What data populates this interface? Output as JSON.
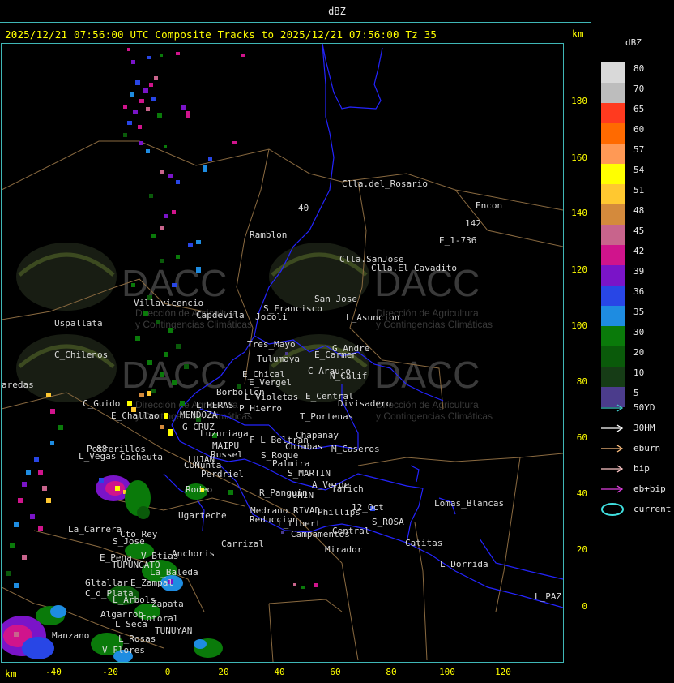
{
  "window_title": "dBZ",
  "subtitle": "2025/12/21 07:56:00 UTC Composite Tracks to 2025/12/21 07:56:00 Tz 35",
  "axis_unit": "km",
  "y_ticks": [
    "180",
    "160",
    "140",
    "120",
    "100",
    "80",
    "60",
    "40",
    "20",
    "0"
  ],
  "x_ticks": [
    "-40",
    "-20",
    "0",
    "20",
    "40",
    "60",
    "80",
    "100",
    "120"
  ],
  "legend": {
    "title": "dBZ",
    "scale": [
      {
        "label": "80",
        "color": "#d9d9d9"
      },
      {
        "label": "70",
        "color": "#bdbdbd"
      },
      {
        "label": "65",
        "color": "#ff3a1f"
      },
      {
        "label": "60",
        "color": "#ff6a00"
      },
      {
        "label": "57",
        "color": "#ff9955"
      },
      {
        "label": "54",
        "color": "#ffff00"
      },
      {
        "label": "51",
        "color": "#ffc830"
      },
      {
        "label": "48",
        "color": "#d48a3c"
      },
      {
        "label": "45",
        "color": "#c8648c"
      },
      {
        "label": "42",
        "color": "#d0148c"
      },
      {
        "label": "39",
        "color": "#7a14c8"
      },
      {
        "label": "36",
        "color": "#2846e6"
      },
      {
        "label": "35",
        "color": "#1e8ce1"
      },
      {
        "label": "30",
        "color": "#0a7a0a"
      },
      {
        "label": "20",
        "color": "#0a5a0a"
      },
      {
        "label": "10",
        "color": "#163c16"
      },
      {
        "label": "5",
        "color": "#4b3c8c"
      }
    ],
    "tracks": [
      {
        "label": "50YD",
        "color": "#40c8c8",
        "icon": "arrow-right-icon"
      },
      {
        "label": "30HM",
        "color": "#ffffff",
        "icon": "arrow-right-icon"
      },
      {
        "label": "eburn",
        "color": "#ffc080",
        "icon": "arrow-right-icon"
      },
      {
        "label": "bip",
        "color": "#ffc8c8",
        "icon": "arrow-right-icon"
      },
      {
        "label": "eb+bip",
        "color": "#e040e0",
        "icon": "arrow-right-icon"
      },
      {
        "label": "current",
        "color": "#40e0e0",
        "icon": "ellipse-icon"
      }
    ]
  },
  "watermark": {
    "brand": "DACC",
    "line1": "Dirección de Agricultura",
    "line2": "y Contingencias Climáticas"
  },
  "places": [
    {
      "name": "Clla.del_Rosario"
    },
    {
      "name": "Encon"
    },
    {
      "name": "142"
    },
    {
      "name": "E_1-736"
    },
    {
      "name": "Ramblon"
    },
    {
      "name": "Clla.SanJose"
    },
    {
      "name": "Clla.El_Cavadito"
    },
    {
      "name": "Villavicencio"
    },
    {
      "name": "Uspallata"
    },
    {
      "name": "Capdevila"
    },
    {
      "name": "S_Francisco"
    },
    {
      "name": "Jocoli"
    },
    {
      "name": "San Jose"
    },
    {
      "name": "L_Asuncion"
    },
    {
      "name": "Tres_Mayo"
    },
    {
      "name": "Tulumaya"
    },
    {
      "name": "G_Andre"
    },
    {
      "name": "E_Carmen"
    },
    {
      "name": "C_Chilenos"
    },
    {
      "name": "E_Chical"
    },
    {
      "name": "E_Vergel"
    },
    {
      "name": "C_Araujo"
    },
    {
      "name": "N_Calif"
    },
    {
      "name": "aredas"
    },
    {
      "name": "Borbollon"
    },
    {
      "name": "L_Violetas"
    },
    {
      "name": "E_Central"
    },
    {
      "name": "Divisadero"
    },
    {
      "name": "C_Guido"
    },
    {
      "name": "L_HERAS"
    },
    {
      "name": "P_Hierro"
    },
    {
      "name": "T_Portenas"
    },
    {
      "name": "E_Challao"
    },
    {
      "name": "MENDOZA"
    },
    {
      "name": "G_CRUZ"
    },
    {
      "name": "Luzuriaga"
    },
    {
      "name": "Chapanay"
    },
    {
      "name": "F_L_Beltran"
    },
    {
      "name": "Chimbas"
    },
    {
      "name": "M_Caseros"
    },
    {
      "name": "Potrerillos"
    },
    {
      "name": "Cacheuta"
    },
    {
      "name": "MAIPU"
    },
    {
      "name": "Russel"
    },
    {
      "name": "L_Vegas"
    },
    {
      "name": "LUJAN"
    },
    {
      "name": "CUNunta"
    },
    {
      "name": "S_Roque"
    },
    {
      "name": "Palmira"
    },
    {
      "name": "Perdriel"
    },
    {
      "name": "S_MARTIN"
    },
    {
      "name": "A_Verde"
    },
    {
      "name": "Rodeo"
    },
    {
      "name": "R_Panquin"
    },
    {
      "name": "JUNIN"
    },
    {
      "name": "Tafich"
    },
    {
      "name": "Lomas_Blancas"
    },
    {
      "name": "Ugarteche"
    },
    {
      "name": "Medrano"
    },
    {
      "name": "RIVAD"
    },
    {
      "name": "Phillips"
    },
    {
      "name": "12_Oct"
    },
    {
      "name": "Reduccion"
    },
    {
      "name": "L_Libert"
    },
    {
      "name": "S_ROSA"
    },
    {
      "name": "La_Carrera"
    },
    {
      "name": "Cto_Rey"
    },
    {
      "name": "S_Jose"
    },
    {
      "name": "Campamentos"
    },
    {
      "name": "Central"
    },
    {
      "name": "Catitas"
    },
    {
      "name": "Carrizal"
    },
    {
      "name": "E_Pena"
    },
    {
      "name": "V_Btias"
    },
    {
      "name": "TUPUNGATO"
    },
    {
      "name": "Anchoris"
    },
    {
      "name": "Mirador"
    },
    {
      "name": "L_Dorrida"
    },
    {
      "name": "La_Baleda"
    },
    {
      "name": "Gltallar"
    },
    {
      "name": "E_Zampal"
    },
    {
      "name": "C_d_Plata"
    },
    {
      "name": "L_Arbols"
    },
    {
      "name": "Zapata"
    },
    {
      "name": "L_PAZ"
    },
    {
      "name": "Algarrob"
    },
    {
      "name": "Cotoral"
    },
    {
      "name": "L_Seca"
    },
    {
      "name": "TUNUYAN"
    },
    {
      "name": "Manzano"
    },
    {
      "name": "L_Rosas"
    },
    {
      "name": "V_Flores"
    },
    {
      "name": "40"
    },
    {
      "name": "88"
    }
  ]
}
